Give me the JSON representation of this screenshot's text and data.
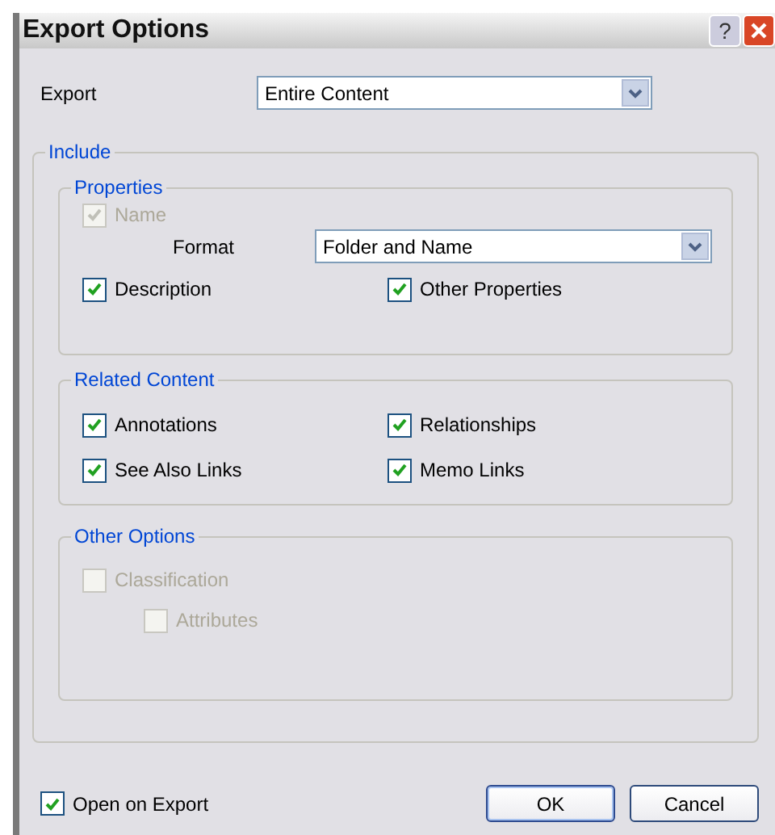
{
  "window": {
    "title": "Export Options",
    "help_glyph": "?"
  },
  "export": {
    "label": "Export",
    "value": "Entire Content"
  },
  "include": {
    "title": "Include",
    "properties": {
      "title": "Properties",
      "name": {
        "label": "Name",
        "checked": true,
        "disabled": true
      },
      "format": {
        "label": "Format",
        "value": "Folder and Name"
      },
      "checkboxes": [
        {
          "label": "Description",
          "checked": true,
          "disabled": false
        },
        {
          "label": "Other Properties",
          "checked": true,
          "disabled": false
        }
      ]
    },
    "related_content": {
      "title": "Related Content",
      "checkboxes": [
        {
          "label": "Annotations",
          "checked": true,
          "disabled": false
        },
        {
          "label": "Relationships",
          "checked": true,
          "disabled": false
        },
        {
          "label": "See Also Links",
          "checked": true,
          "disabled": false
        },
        {
          "label": "Memo Links",
          "checked": true,
          "disabled": false
        }
      ]
    },
    "other_options": {
      "title": "Other Options",
      "classification": {
        "label": "Classification",
        "checked": false,
        "disabled": true
      },
      "attributes": {
        "label": "Attributes",
        "checked": false,
        "disabled": true
      }
    }
  },
  "open_on_export": {
    "label": "Open on Export",
    "checked": true,
    "disabled": false
  },
  "buttons": [
    "OK",
    "Cancel"
  ]
}
